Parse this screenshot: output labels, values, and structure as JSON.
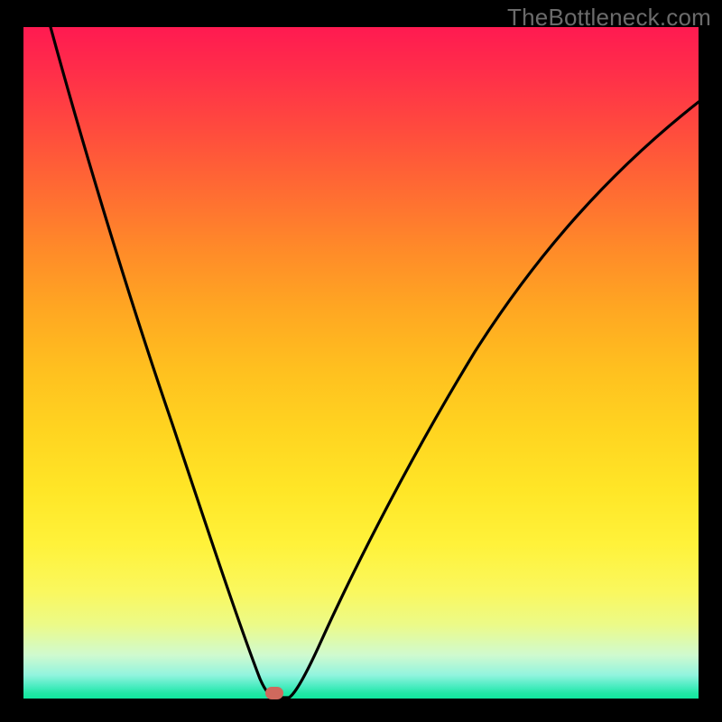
{
  "watermark": "TheBottleneck.com",
  "colors": {
    "top": "#ff1a51",
    "bottom": "#10e79f",
    "curve": "#000000",
    "marker": "#cf695d",
    "page_bg": "#000000"
  },
  "chart_data": {
    "type": "line",
    "title": "",
    "xlabel": "",
    "ylabel": "",
    "xlim": [
      0,
      100
    ],
    "ylim": [
      0,
      100
    ],
    "grid": false,
    "legend": false,
    "annotations": [
      {
        "kind": "marker",
        "x": 37.4,
        "y": 0.6,
        "color": "#cf695d",
        "shape": "pill"
      }
    ],
    "series": [
      {
        "name": "curve",
        "color": "#000000",
        "x": [
          0,
          5,
          10,
          15,
          20,
          25,
          30,
          34,
          37,
          38,
          39.5,
          43,
          50,
          58,
          66,
          74,
          82,
          90,
          98,
          100
        ],
        "y": [
          100,
          84,
          69,
          55,
          42,
          30,
          18,
          8,
          1,
          0,
          0,
          7,
          22,
          38,
          52,
          64,
          74,
          81,
          87,
          89
        ]
      }
    ],
    "background_gradient": {
      "direction": "vertical",
      "stops": [
        {
          "pos": 0.0,
          "color": "#ff1a51"
        },
        {
          "pos": 0.2,
          "color": "#ff5a38"
        },
        {
          "pos": 0.4,
          "color": "#ff9e24"
        },
        {
          "pos": 0.6,
          "color": "#ffd420"
        },
        {
          "pos": 0.78,
          "color": "#fff23a"
        },
        {
          "pos": 0.9,
          "color": "#e6fa9a"
        },
        {
          "pos": 0.97,
          "color": "#7af0cd"
        },
        {
          "pos": 1.0,
          "color": "#10e79f"
        }
      ]
    }
  }
}
